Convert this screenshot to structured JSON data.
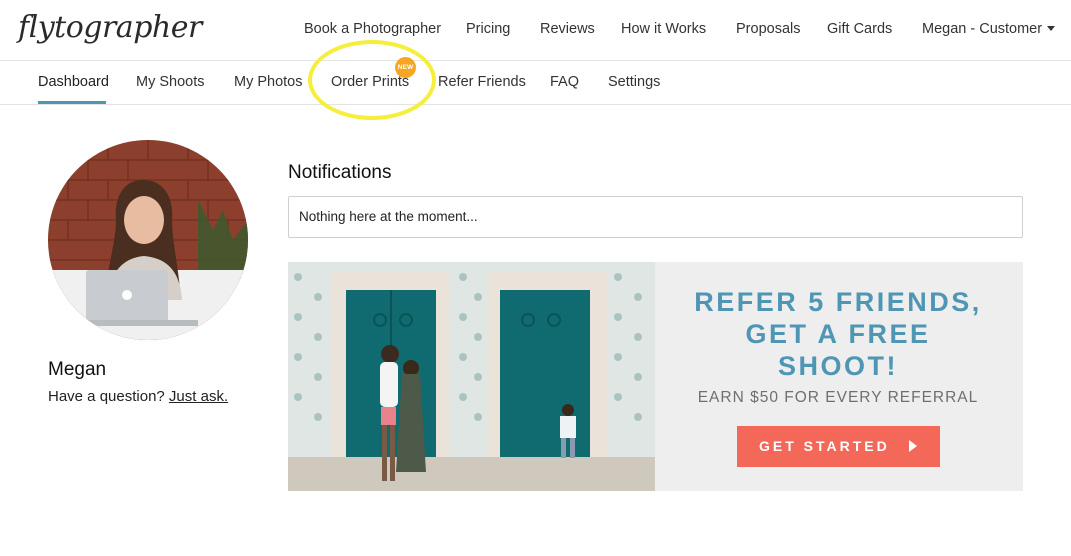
{
  "brand": {
    "logo_text": "flytographer"
  },
  "topnav": {
    "items": [
      {
        "label": "Book a Photographer"
      },
      {
        "label": "Pricing"
      },
      {
        "label": "Reviews"
      },
      {
        "label": "How it Works"
      },
      {
        "label": "Proposals"
      },
      {
        "label": "Gift Cards"
      }
    ],
    "account": {
      "label": "Megan - Customer",
      "icon": "caret-down-icon"
    }
  },
  "subnav": {
    "items": [
      {
        "label": "Dashboard",
        "active": true
      },
      {
        "label": "My Shoots"
      },
      {
        "label": "My Photos"
      },
      {
        "label": "Order Prints",
        "badge": "NEW"
      },
      {
        "label": "Refer Friends"
      },
      {
        "label": "FAQ"
      },
      {
        "label": "Settings"
      }
    ],
    "accent_color": "#4f96b5",
    "badge_color": "#f6a623",
    "highlight_color": "#f5ee3b"
  },
  "profile": {
    "name": "Megan",
    "question_prefix": "Have a question?",
    "question_link": "Just ask."
  },
  "notifications": {
    "title": "Notifications",
    "empty_text": "Nothing here at the moment..."
  },
  "banner": {
    "headline_lines": [
      "REFER 5 FRIENDS,",
      "GET A FREE",
      "SHOOT!"
    ],
    "subtext": "EARN $50 FOR EVERY REFERRAL",
    "cta_label": "GET STARTED",
    "cta_color": "#f4685a",
    "headline_color": "#4f96b5"
  }
}
